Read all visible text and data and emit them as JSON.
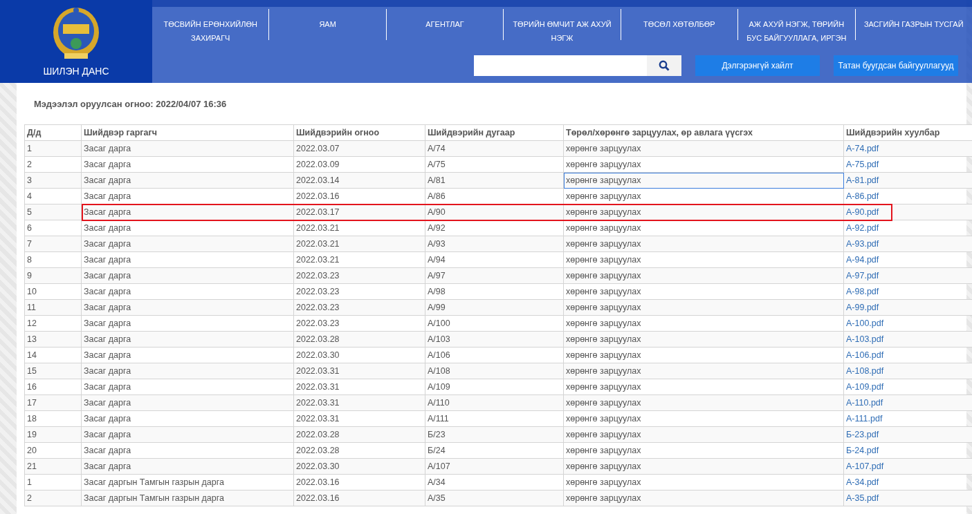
{
  "header": {
    "logo_text": "ШИЛЭН ДАНС",
    "nav": [
      {
        "label": "ТӨСВИЙН ЕРӨНХИЙЛӨН ЗАХИРАГЧ"
      },
      {
        "label": "ЯАМ"
      },
      {
        "label": "АГЕНТЛАГ"
      },
      {
        "label": "ТӨРИЙН ӨМЧИТ АЖ АХУЙ НЭГЖ"
      },
      {
        "label": "ТӨСӨЛ ХӨТӨЛБӨР"
      },
      {
        "label": "АЖ АХУЙ НЭГЖ, ТӨРИЙН БУС БАЙГУУЛЛАГА, ИРГЭН"
      },
      {
        "label": "ЗАСГИЙН ГАЗРЫН ТУСГАЙ"
      }
    ],
    "buttons": [
      "Дэлгэрэнгүй хайлт",
      "Татан буугдсан байгууллагууд"
    ]
  },
  "page": {
    "updated": "Мэдээлэл оруулсан огноо: 2022/04/07 16:36"
  },
  "table": {
    "columns": [
      "Д/д",
      "Шийдвэр гаргагч",
      "Шийдвэрийн огноо",
      "Шийдвэрийн дугаар",
      "Төрөл/хөрөнгө зарцуулах, өр авлага үүсгэх",
      "Шийдвэрийн хуулбар"
    ],
    "rows": [
      {
        "cells": [
          "1",
          "Засаг дарга",
          "2022.03.07",
          "А/74",
          "хөрөнгө зарцуулах",
          "А-74.pdf"
        ],
        "cell_selected": false,
        "highlighted": false
      },
      {
        "cells": [
          "2",
          "Засаг дарга",
          "2022.03.09",
          "А/75",
          "хөрөнгө зарцуулах",
          "А-75.pdf"
        ],
        "cell_selected": false,
        "highlighted": false
      },
      {
        "cells": [
          "3",
          "Засаг дарга",
          "2022.03.14",
          "А/81",
          "хөрөнгө зарцуулах",
          "А-81.pdf"
        ],
        "cell_selected": true,
        "highlighted": false
      },
      {
        "cells": [
          "4",
          "Засаг дарга",
          "2022.03.16",
          "А/86",
          "хөрөнгө зарцуулах",
          "А-86.pdf"
        ],
        "cell_selected": false,
        "highlighted": false
      },
      {
        "cells": [
          "5",
          "Засаг дарга",
          "2022.03.17",
          "А/90",
          "хөрөнгө зарцуулах",
          "А-90.pdf"
        ],
        "cell_selected": false,
        "highlighted": true
      },
      {
        "cells": [
          "6",
          "Засаг дарга",
          "2022.03.21",
          "А/92",
          "хөрөнгө зарцуулах",
          "А-92.pdf"
        ],
        "cell_selected": false,
        "highlighted": false
      },
      {
        "cells": [
          "7",
          "Засаг дарга",
          "2022.03.21",
          "А/93",
          "хөрөнгө зарцуулах",
          "А-93.pdf"
        ],
        "cell_selected": false,
        "highlighted": false
      },
      {
        "cells": [
          "8",
          "Засаг дарга",
          "2022.03.21",
          "А/94",
          "хөрөнгө зарцуулах",
          "А-94.pdf"
        ],
        "cell_selected": false,
        "highlighted": false
      },
      {
        "cells": [
          "9",
          "Засаг дарга",
          "2022.03.23",
          "А/97",
          "хөрөнгө зарцуулах",
          "А-97.pdf"
        ],
        "cell_selected": false,
        "highlighted": false
      },
      {
        "cells": [
          "10",
          "Засаг дарга",
          "2022.03.23",
          "А/98",
          "хөрөнгө зарцуулах",
          "А-98.pdf"
        ],
        "cell_selected": false,
        "highlighted": false
      },
      {
        "cells": [
          "11",
          "Засаг дарга",
          "2022.03.23",
          "А/99",
          "хөрөнгө зарцуулах",
          "А-99.pdf"
        ],
        "cell_selected": false,
        "highlighted": false
      },
      {
        "cells": [
          "12",
          "Засаг дарга",
          "2022.03.23",
          "А/100",
          "хөрөнгө зарцуулах",
          "А-100.pdf"
        ],
        "cell_selected": false,
        "highlighted": false
      },
      {
        "cells": [
          "13",
          "Засаг дарга",
          "2022.03.28",
          "А/103",
          "хөрөнгө зарцуулах",
          "А-103.pdf"
        ],
        "cell_selected": false,
        "highlighted": false
      },
      {
        "cells": [
          "14",
          "Засаг дарга",
          "2022.03.30",
          "А/106",
          "хөрөнгө зарцуулах",
          "А-106.pdf"
        ],
        "cell_selected": false,
        "highlighted": false
      },
      {
        "cells": [
          "15",
          "Засаг дарга",
          "2022.03.31",
          "А/108",
          "хөрөнгө зарцуулах",
          "А-108.pdf"
        ],
        "cell_selected": false,
        "highlighted": false
      },
      {
        "cells": [
          "16",
          "Засаг дарга",
          "2022.03.31",
          "А/109",
          "хөрөнгө зарцуулах",
          "А-109.pdf"
        ],
        "cell_selected": false,
        "highlighted": false
      },
      {
        "cells": [
          "17",
          "Засаг дарга",
          "2022.03.31",
          "А/110",
          "хөрөнгө зарцуулах",
          "А-110.pdf"
        ],
        "cell_selected": false,
        "highlighted": false
      },
      {
        "cells": [
          "18",
          "Засаг дарга",
          "2022.03.31",
          "А/111",
          "хөрөнгө зарцуулах",
          "А-111.pdf"
        ],
        "cell_selected": false,
        "highlighted": false
      },
      {
        "cells": [
          "19",
          "Засаг дарга",
          "2022.03.28",
          "Б/23",
          "хөрөнгө зарцуулах",
          "Б-23.pdf"
        ],
        "cell_selected": false,
        "highlighted": false
      },
      {
        "cells": [
          "20",
          "Засаг дарга",
          "2022.03.28",
          "Б/24",
          "хөрөнгө зарцуулах",
          "Б-24.pdf"
        ],
        "cell_selected": false,
        "highlighted": false
      },
      {
        "cells": [
          "21",
          "Засаг дарга",
          "2022.03.30",
          "А/107",
          "хөрөнгө зарцуулах",
          "А-107.pdf"
        ],
        "cell_selected": false,
        "highlighted": false
      },
      {
        "cells": [
          "1",
          "Засаг даргын Тамгын газрын дарга",
          "2022.03.16",
          "А/34",
          "хөрөнгө зарцуулах",
          "А-34.pdf"
        ],
        "cell_selected": false,
        "highlighted": false
      },
      {
        "cells": [
          "2",
          "Засаг даргын Тамгын газрын дарга",
          "2022.03.16",
          "А/35",
          "хөрөнгө зарцуулах",
          "А-35.pdf"
        ],
        "cell_selected": false,
        "highlighted": false
      }
    ]
  }
}
